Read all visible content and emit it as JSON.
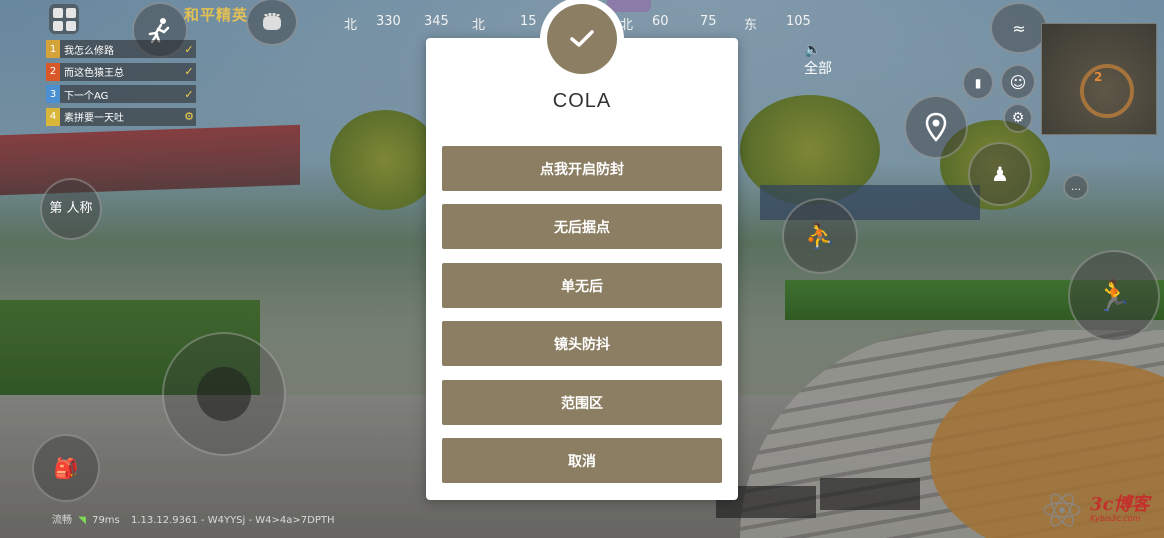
{
  "hud": {
    "mode_title": "和平精英",
    "team": [
      {
        "num": "1",
        "name": "我怎么修路",
        "color": "#d4a33a"
      },
      {
        "num": "2",
        "name": "而这色猿王总",
        "color": "#d9582a"
      },
      {
        "num": "3",
        "name": "下一个AG",
        "color": "#4a8fd1"
      },
      {
        "num": "4",
        "name": "素拼要一天吐",
        "color": "#d9b53a"
      }
    ],
    "compass": [
      "北",
      "330",
      "345",
      "北",
      "15",
      "北",
      "60",
      "75",
      "东",
      "105"
    ],
    "audio_label": "全部",
    "perspective_label": "第 人称",
    "minimap_number": "2",
    "status_ping": "79ms",
    "status_text": "1.13.12.9361 - W4YYSj - W4>4a>7DPTH",
    "status_prefix": "流畅",
    "watermark": "3c博客",
    "watermark_sub": "Kybis3c.com"
  },
  "dialog": {
    "title": "COLA",
    "buttons": [
      {
        "label": "点我开启防封"
      },
      {
        "label": "无后据点"
      },
      {
        "label": "单无后"
      },
      {
        "label": "镜头防抖"
      },
      {
        "label": "范围区"
      },
      {
        "label": "取消"
      }
    ]
  },
  "colors": {
    "accent": "#8b7e62",
    "dialog_bg": "#ffffff",
    "title_text": "#333333",
    "hud_gold": "#e2c052"
  }
}
